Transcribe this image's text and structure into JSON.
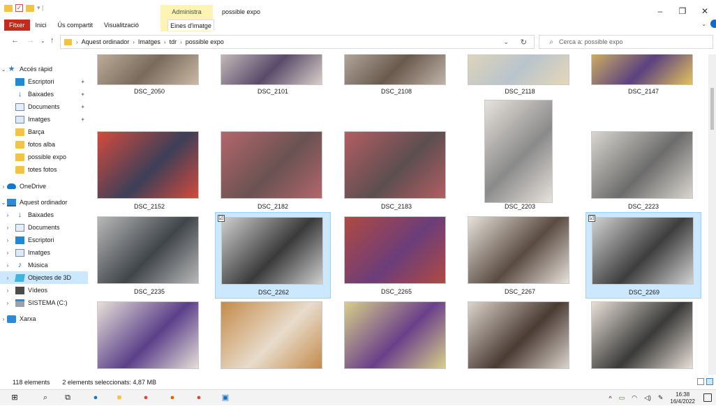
{
  "window": {
    "title": "possible expo",
    "context_tab_title": "Administra",
    "minimize": "–",
    "maximize": "❐",
    "close": "✕"
  },
  "ribbon": {
    "tabs": [
      "Fitxer",
      "Inici",
      "Ús compartit",
      "Visualització"
    ],
    "context_tab": "Eines d'imatge",
    "expand": "⌄"
  },
  "address": {
    "crumbs": [
      "Aquest ordinador",
      "Imatges",
      "tdr",
      "possible expo"
    ],
    "search_placeholder": "Cerca a: possible expo"
  },
  "nav": {
    "quick_access": "Accés ràpid",
    "quick_items": [
      {
        "label": "Escriptori",
        "pinned": true
      },
      {
        "label": "Baixades",
        "pinned": true
      },
      {
        "label": "Documents",
        "pinned": true
      },
      {
        "label": "Imatges",
        "pinned": true
      },
      {
        "label": "Barça",
        "pinned": false
      },
      {
        "label": "fotos alba",
        "pinned": false
      },
      {
        "label": "possible expo",
        "pinned": false
      },
      {
        "label": "totes fotos",
        "pinned": false
      }
    ],
    "onedrive": "OneDrive",
    "this_pc": "Aquest ordinador",
    "pc_items": [
      "Baixades",
      "Documents",
      "Escriptori",
      "Imatges",
      "Música",
      "Objectes de 3D",
      "Vídeos",
      "SISTEMA (C:)"
    ],
    "network": "Xarxa"
  },
  "files": [
    {
      "name": "DSC_2050",
      "selected": false
    },
    {
      "name": "DSC_2101",
      "selected": false
    },
    {
      "name": "DSC_2108",
      "selected": false
    },
    {
      "name": "DSC_2118",
      "selected": false
    },
    {
      "name": "DSC_2147",
      "selected": false
    },
    {
      "name": "DSC_2152",
      "selected": false
    },
    {
      "name": "DSC_2182",
      "selected": false
    },
    {
      "name": "DSC_2183",
      "selected": false
    },
    {
      "name": "DSC_2203",
      "selected": false
    },
    {
      "name": "DSC_2223",
      "selected": false
    },
    {
      "name": "DSC_2235",
      "selected": false
    },
    {
      "name": "DSC_2262",
      "selected": true
    },
    {
      "name": "DSC_2265",
      "selected": false
    },
    {
      "name": "DSC_2267",
      "selected": false
    },
    {
      "name": "DSC_2269",
      "selected": true
    },
    {
      "name": "",
      "selected": false
    },
    {
      "name": "",
      "selected": false
    },
    {
      "name": "",
      "selected": false
    },
    {
      "name": "",
      "selected": false
    },
    {
      "name": "",
      "selected": false
    }
  ],
  "status": {
    "count": "118 elements",
    "selection": "2 elements seleccionats: 4,87 MB"
  },
  "taskbar": {
    "time": "16:38",
    "date": "16/4/2022"
  },
  "colors": {
    "accent": "#0078d4",
    "selection_bg": "#cce8ff",
    "file_tab": "#c42b1c",
    "context_tab": "#fdf4b3"
  }
}
